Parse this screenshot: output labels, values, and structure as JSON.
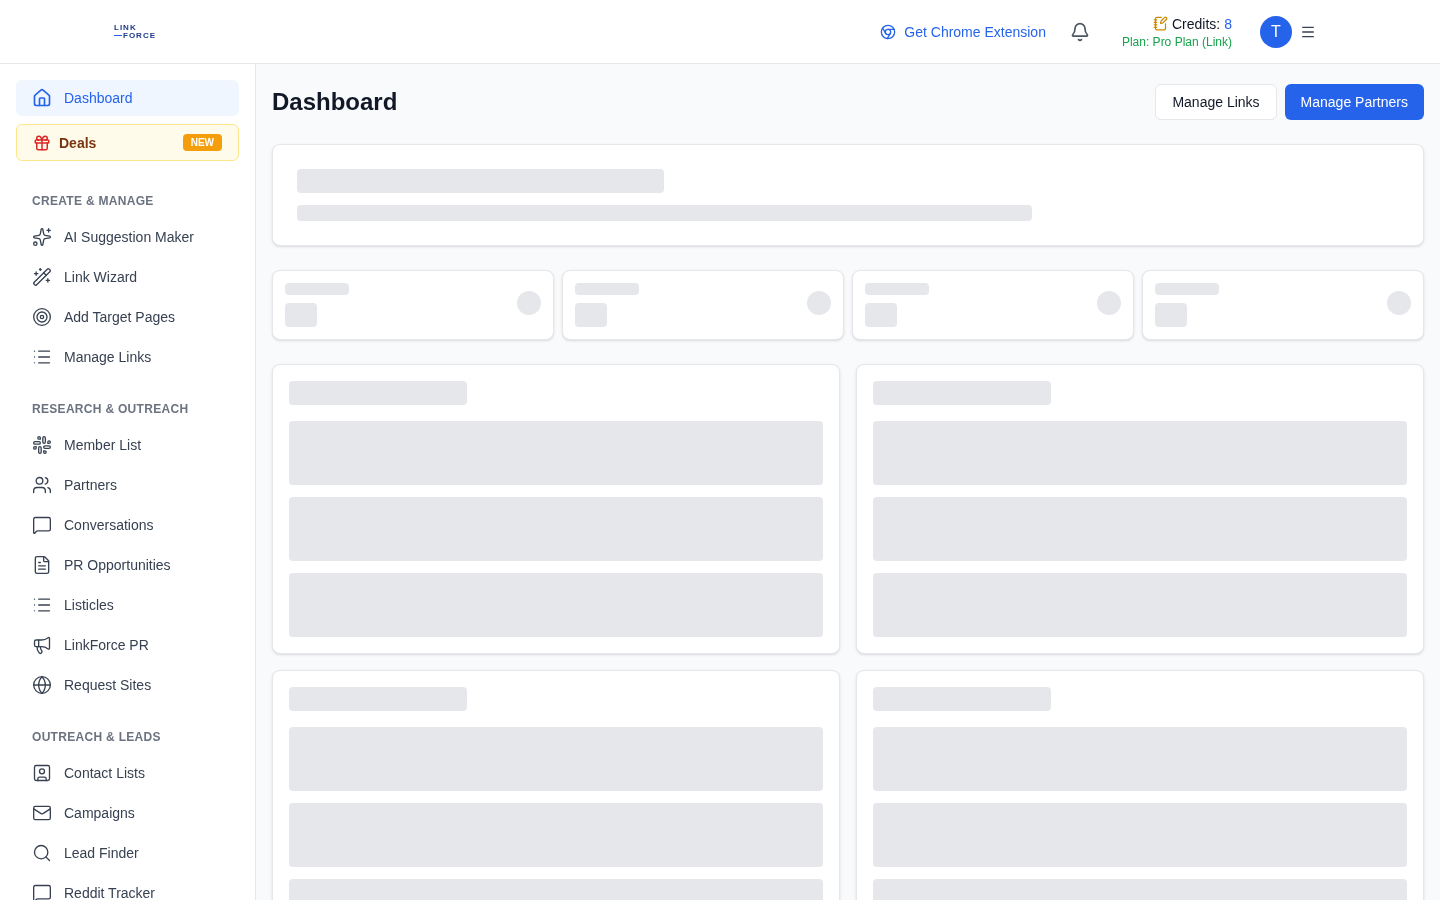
{
  "header": {
    "logo": {
      "top": "LINK",
      "bottom": "FORCE"
    },
    "extension_link": "Get Chrome Extension",
    "credits_label": "Credits:",
    "credits_value": "8",
    "plan": "Plan: Pro Plan (Link)",
    "avatar": "T"
  },
  "sidebar": {
    "top_items": [
      {
        "kind": "nav",
        "label": "Dashboard",
        "selected": true
      },
      {
        "kind": "promo",
        "label": "Deals",
        "badge": "NEW",
        "selected": false
      }
    ],
    "sections": [
      {
        "title": "CREATE & MANAGE",
        "items": [
          {
            "label": "AI Suggestion Maker",
            "selected": false
          },
          {
            "label": "Link Wizard",
            "selected": false
          },
          {
            "label": "Add Target Pages",
            "selected": false
          },
          {
            "label": "Manage Links",
            "selected": false
          }
        ]
      },
      {
        "title": "RESEARCH & OUTREACH",
        "items": [
          {
            "label": "Member List",
            "selected": false
          },
          {
            "label": "Partners",
            "selected": false
          },
          {
            "label": "Conversations",
            "selected": false
          },
          {
            "label": "PR Opportunities",
            "selected": false
          },
          {
            "label": "Listicles",
            "selected": false
          },
          {
            "label": "LinkForce PR",
            "selected": false
          },
          {
            "label": "Request Sites",
            "selected": false
          }
        ]
      },
      {
        "title": "OUTREACH & LEADS",
        "items": [
          {
            "label": "Contact Lists",
            "selected": false
          },
          {
            "label": "Campaigns",
            "selected": false
          },
          {
            "label": "Lead Finder",
            "selected": false
          },
          {
            "label": "Reddit Tracker",
            "selected": false
          }
        ]
      }
    ]
  },
  "page": {
    "title": "Dashboard",
    "buttons": [
      {
        "label": "Manage Links",
        "kind": "secondary"
      },
      {
        "label": "Manage Partners",
        "kind": "primary"
      }
    ]
  }
}
